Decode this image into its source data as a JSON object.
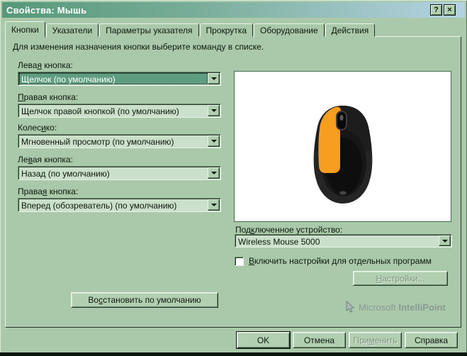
{
  "colors": {
    "face": "#aac9aa",
    "field": "#cbe0cb",
    "selection": "#5f9d80",
    "title_gradient_start": "#569879",
    "title_gradient_end": "#b5d3e2",
    "white_panel": "#ffffff",
    "mouse_accent_orange": "#f79d1f",
    "disabled_text": "#7c927c",
    "brand_text": "#8a9a96"
  },
  "titlebar": {
    "title": "Свойства: Мышь",
    "help_icon": "?",
    "close_icon": "×"
  },
  "tabs": [
    {
      "label": "Кнопки"
    },
    {
      "label": "Указатели"
    },
    {
      "label": "Параметры указателя"
    },
    {
      "label": "Прокрутка"
    },
    {
      "label": "Оборудование"
    },
    {
      "label": "Действия"
    }
  ],
  "instruction": "Для изменения назначения кнопки выберите команду в списке.",
  "combos": [
    {
      "label_pre": "Лева",
      "label_accel": "я",
      "label_post": " кнопка:",
      "value": "Щелчок (по умолчанию)"
    },
    {
      "label_pre": "",
      "label_accel": "П",
      "label_post": "равая кнопка:",
      "value": "Щелчок правой кнопкой (по умолчанию)"
    },
    {
      "label_pre": "Колес",
      "label_accel": "и",
      "label_post": "ко:",
      "value": "Мгновенный просмотр (по умолчанию)"
    },
    {
      "label_pre": "Ле",
      "label_accel": "в",
      "label_post": "ая кнопка:",
      "value": "Назад (по умолчанию)"
    },
    {
      "label_pre": "Права",
      "label_accel": "я",
      "label_post": " кнопка:",
      "value": "Вперед (обозреватель) (по умолчанию)"
    }
  ],
  "device": {
    "label_pre": "Под",
    "label_accel": "к",
    "label_post": "люченное устройство:",
    "value": "Wireless Mouse 5000"
  },
  "per_program_checkbox": {
    "label_pre": "",
    "label_accel": "В",
    "label_post": "ключить настройки для отдельных программ",
    "checked": false
  },
  "settings_button": {
    "label_pre": "",
    "label_accel": "Н",
    "label_post": "астройки...",
    "enabled": false
  },
  "restore_button": {
    "label_pre": "Во",
    "label_accel": "с",
    "label_post": "становить по умолчанию"
  },
  "branding": {
    "vendor": "Microsoft",
    "product": "IntelliPoint"
  },
  "footer_buttons": {
    "ok": "OK",
    "cancel": "Отмена",
    "apply_pre": "При",
    "apply_accel": "м",
    "apply_post": "енить",
    "help": "Справка"
  }
}
